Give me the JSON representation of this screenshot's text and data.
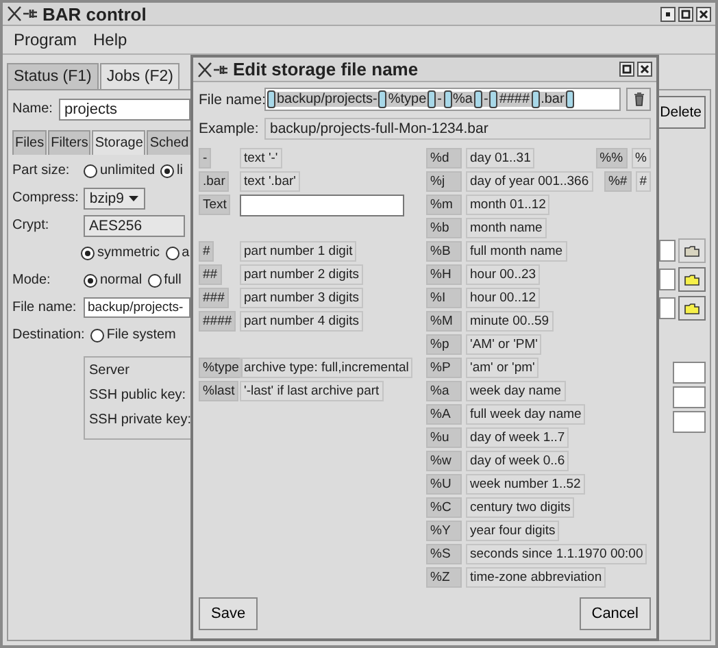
{
  "window": {
    "title": "BAR control"
  },
  "menu": [
    "Program",
    "Help"
  ],
  "tabs": [
    {
      "label": "Status (F1)",
      "selected": false
    },
    {
      "label": "Jobs (F2)",
      "selected": true
    }
  ],
  "job": {
    "name_label": "Name:",
    "name": "projects",
    "delete_button": "Delete"
  },
  "sub_tabs": [
    {
      "label": "Files",
      "selected": false
    },
    {
      "label": "Filters",
      "selected": false
    },
    {
      "label": "Storage",
      "selected": true
    },
    {
      "label": "Sched",
      "selected": false
    }
  ],
  "storage": {
    "part_size": {
      "label": "Part size:",
      "options": [
        {
          "label": "unlimited",
          "selected": false
        },
        {
          "label": "li",
          "selected": true
        }
      ]
    },
    "compress": {
      "label": "Compress:",
      "value": "bzip9"
    },
    "crypt": {
      "label": "Crypt:",
      "value": "AES256",
      "options": [
        {
          "label": "symmetric",
          "selected": true
        },
        {
          "label": "a",
          "selected": false
        }
      ]
    },
    "mode": {
      "label": "Mode:",
      "options": [
        {
          "label": "normal",
          "selected": true
        },
        {
          "label": "full",
          "selected": false
        }
      ]
    },
    "file_name": {
      "label": "File name:",
      "value": "backup/projects-"
    },
    "destination": {
      "label": "Destination:",
      "options": [
        {
          "label": "File system",
          "selected": false
        }
      ]
    },
    "server_labels": [
      "Server",
      "SSH public key:",
      "SSH private key:"
    ],
    "folder_buttons": [
      {
        "disabled": true
      },
      {
        "disabled": false
      },
      {
        "disabled": false
      }
    ]
  },
  "dialog": {
    "title": "Edit storage file name",
    "file_name_label": "File name:",
    "file_name_parts": [
      "backup/projects-",
      "%type",
      "-",
      "%a",
      "-",
      "####",
      ".bar"
    ],
    "example_label": "Example:",
    "example": "backup/projects-full-Mon-1234.bar",
    "text_parts": [
      {
        "kind": "fixed",
        "key": "-",
        "description": "text '-'"
      },
      {
        "kind": "fixed",
        "key": ".bar",
        "description": "text '.bar'"
      },
      {
        "kind": "input",
        "key": "Text"
      }
    ],
    "part_numbers": [
      {
        "key": "#",
        "description": "part number 1 digit"
      },
      {
        "key": "##",
        "description": "part number 2 digits"
      },
      {
        "key": "###",
        "description": "part number 3 digits"
      },
      {
        "key": "####",
        "description": "part number 4 digits"
      }
    ],
    "archive_parts": [
      {
        "key": "%type",
        "description": "archive type: full,incremental"
      },
      {
        "key": "%last",
        "description": "'-last' if last archive part"
      }
    ],
    "date_parts": [
      {
        "key": "%d",
        "description": "day 01..31"
      },
      {
        "key": "%j",
        "description": "day of year 001..366"
      },
      {
        "key": "%m",
        "description": "month 01..12"
      },
      {
        "key": "%b",
        "description": "month name"
      },
      {
        "key": "%B",
        "description": "full month name"
      },
      {
        "key": "%H",
        "description": "hour 00..23"
      },
      {
        "key": "%I",
        "description": "hour 00..12"
      },
      {
        "key": "%M",
        "description": "minute 00..59"
      },
      {
        "key": "%p",
        "description": "'AM' or 'PM'"
      },
      {
        "key": "%P",
        "description": "'am' or 'pm'"
      },
      {
        "key": "%a",
        "description": "week day name"
      },
      {
        "key": "%A",
        "description": "full week day name"
      },
      {
        "key": "%u",
        "description": "day of week 1..7"
      },
      {
        "key": "%w",
        "description": "day of week 0..6"
      },
      {
        "key": "%U",
        "description": "week number 1..52"
      },
      {
        "key": "%C",
        "description": "century two digits"
      },
      {
        "key": "%Y",
        "description": "year four digits"
      },
      {
        "key": "%S",
        "description": "seconds since 1.1.1970 00:00"
      },
      {
        "key": "%Z",
        "description": "time-zone abbreviation"
      }
    ],
    "special_parts": [
      {
        "key": "%%",
        "description": "%"
      },
      {
        "key": "%#",
        "description": "#"
      }
    ],
    "buttons": [
      "Save",
      "Cancel"
    ]
  }
}
